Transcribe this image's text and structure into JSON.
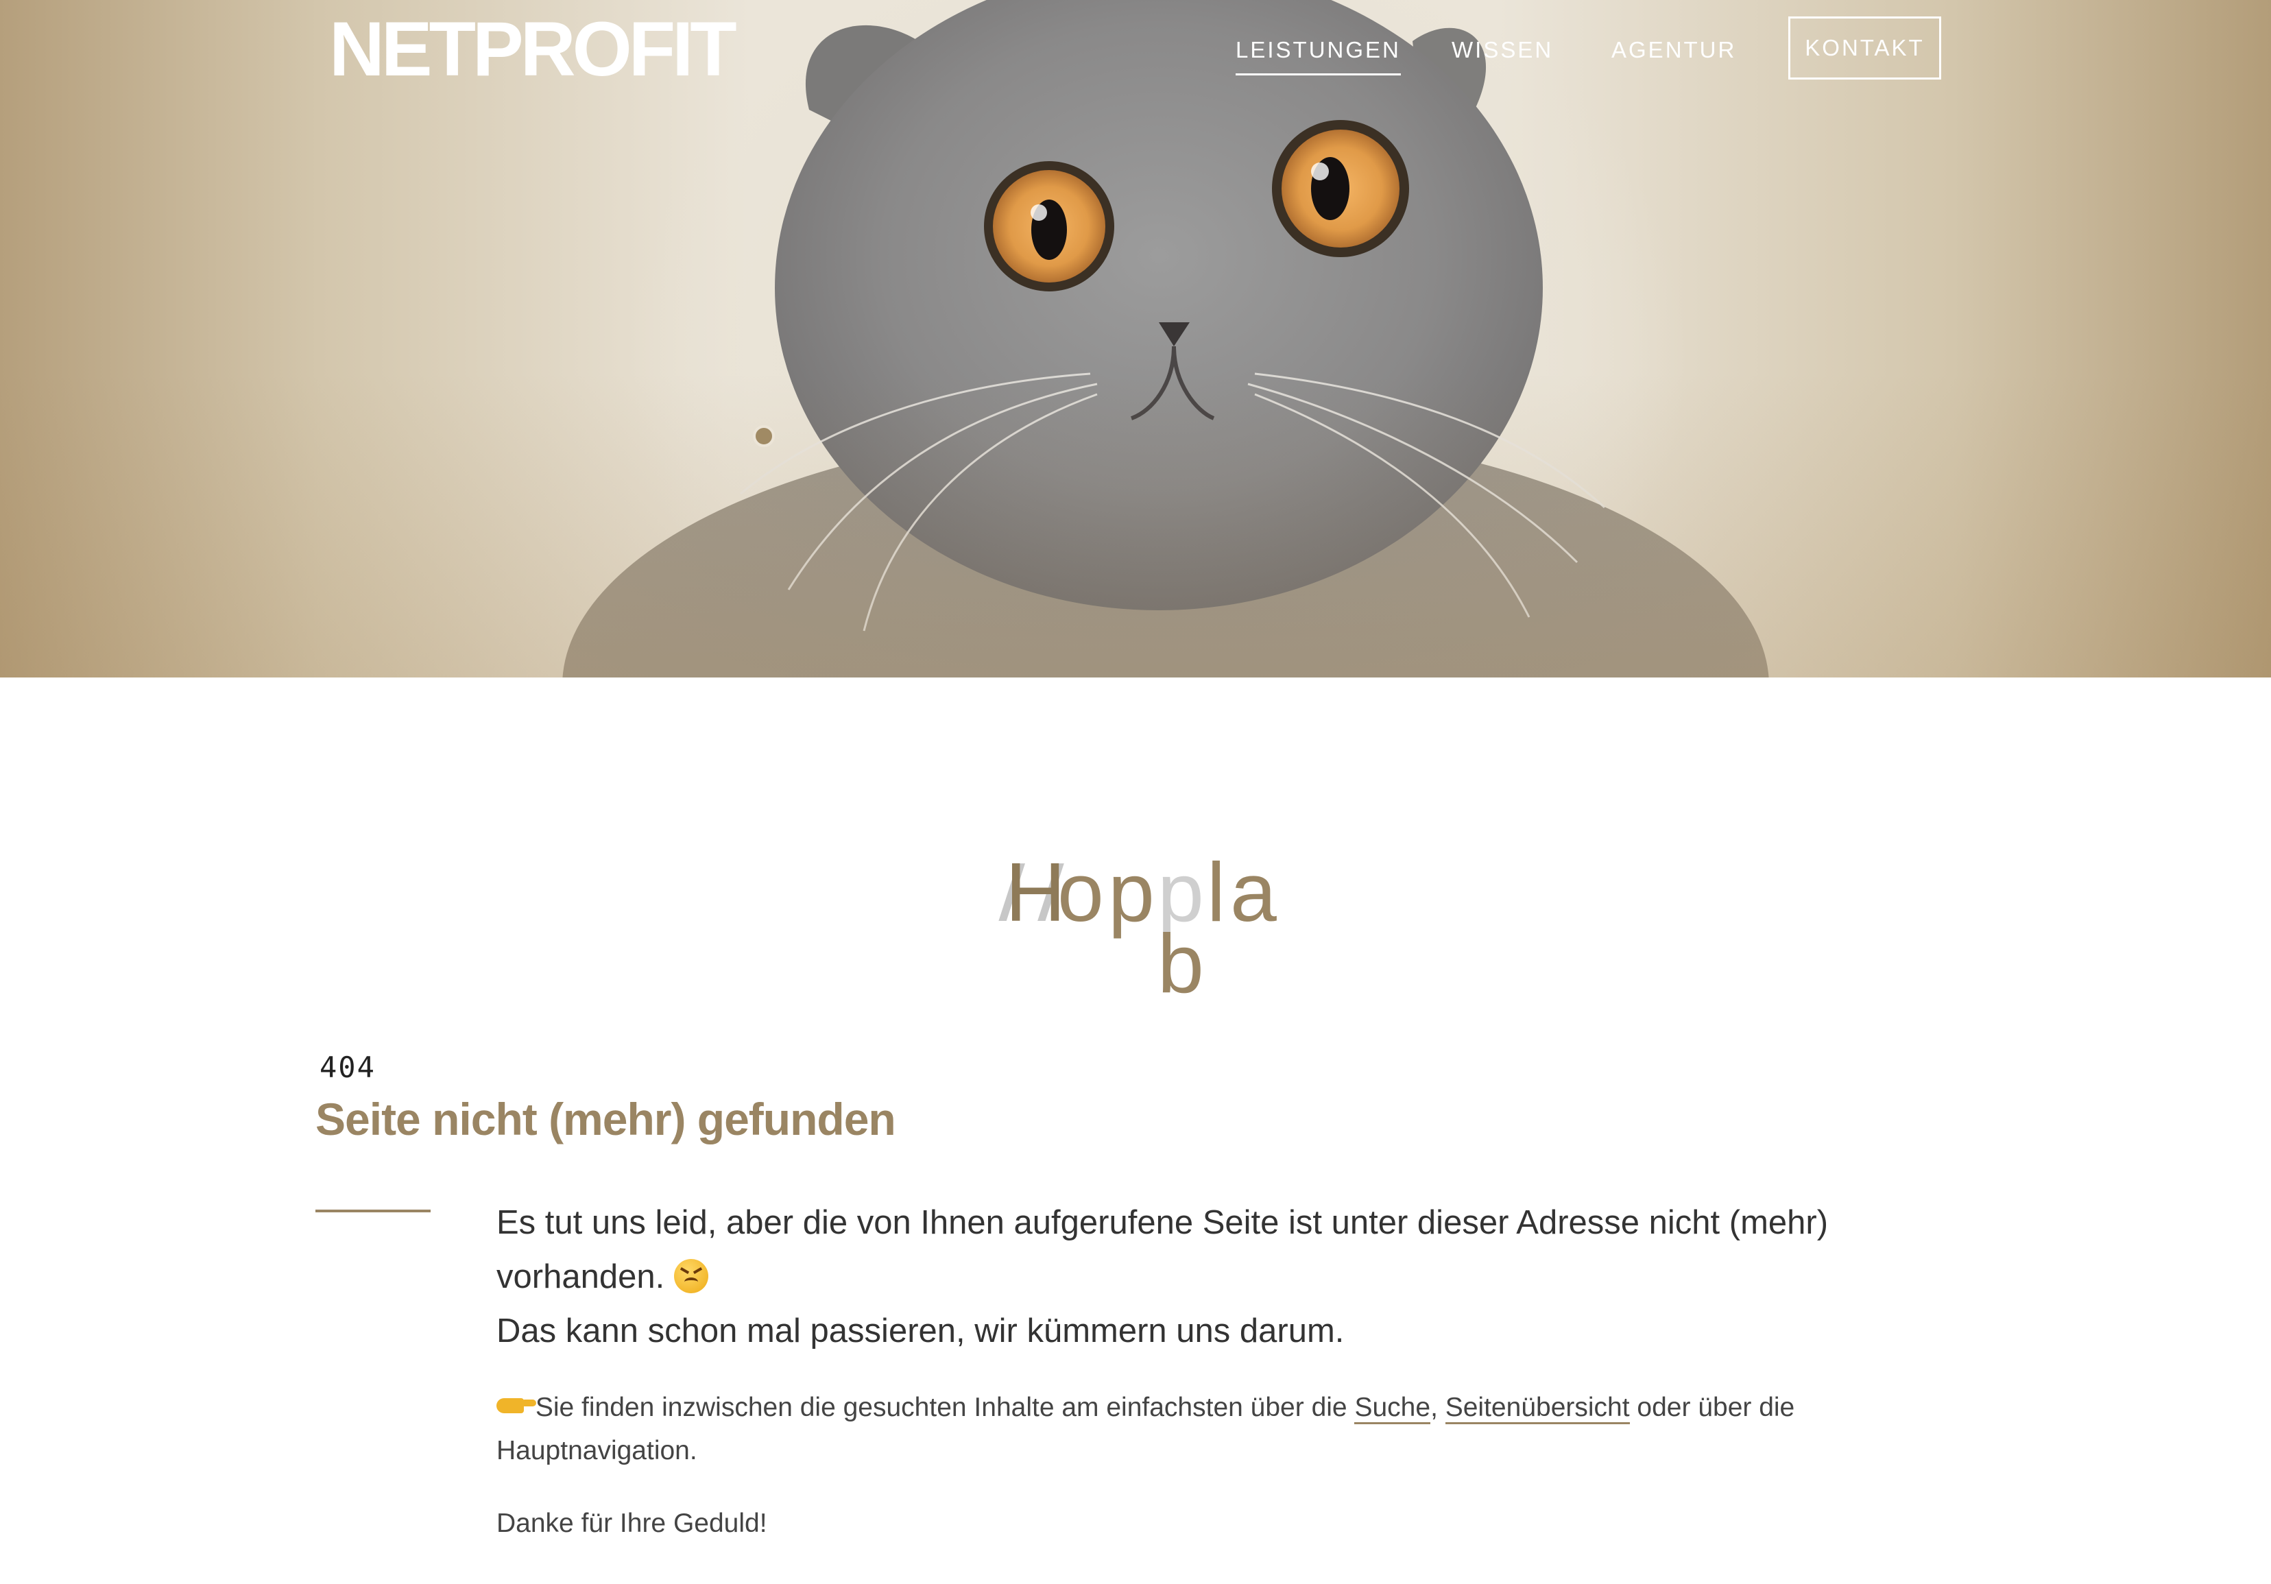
{
  "brand": {
    "logo": "NETPROFIT"
  },
  "nav": {
    "items": [
      {
        "label": "LEISTUNGEN",
        "active": true
      },
      {
        "label": "WISSEN",
        "active": false
      },
      {
        "label": "AGENTUR",
        "active": false
      }
    ],
    "contact": "KONTAKT"
  },
  "hero": {
    "image_subject": "scottish-fold-cat-photo"
  },
  "hoppla": {
    "letters": [
      "H",
      "o",
      "p",
      "p",
      "l",
      "a",
      "b"
    ]
  },
  "error": {
    "code": "404",
    "title": "Seite nicht (mehr) gefunden",
    "lead_line1": "Es tut uns leid, aber die von Ihnen aufgerufene Seite ist unter dieser Adresse nicht (mehr) vorhanden.",
    "lead_line2": "Das kann schon mal passieren, wir kümmern uns darum.",
    "hint_prefix": "Sie finden inzwischen die gesuchten Inhalte am einfachsten über die",
    "link_search": "Suche",
    "link_sitemap": "Seitenübersicht",
    "hint_suffix": "oder über die Hauptnavigation.",
    "thanks": "Danke für Ihre Geduld!"
  },
  "colors": {
    "accent": "#9a8563",
    "text": "#333333",
    "hero_bg": "#ebe5d9"
  }
}
